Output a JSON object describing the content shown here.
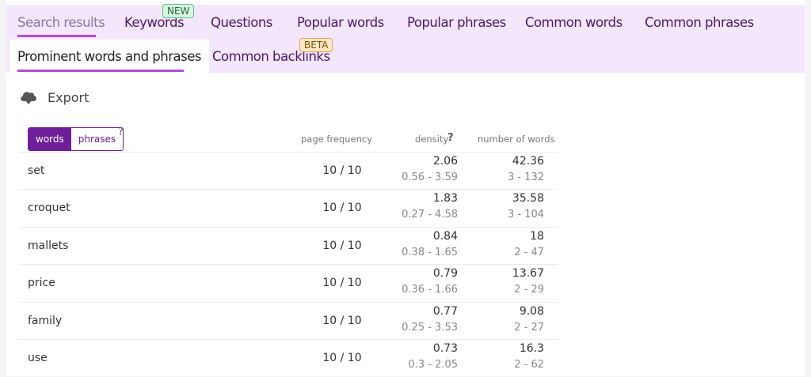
{
  "tabs_row1": [
    {
      "label": "Search results"
    },
    {
      "label": "Keywords",
      "badge": "NEW"
    },
    {
      "label": "Questions"
    },
    {
      "label": "Popular words"
    },
    {
      "label": "Popular phrases"
    },
    {
      "label": "Common words"
    },
    {
      "label": "Common phrases"
    }
  ],
  "tabs_row2": [
    {
      "label": "Prominent words and phrases"
    },
    {
      "label": "Common backlinks",
      "badge": "BETA"
    }
  ],
  "export_label": "Export",
  "toggle": {
    "words": "words",
    "phrases": "phrases",
    "help": "?"
  },
  "columns": {
    "page_frequency": "page frequency",
    "density": "density",
    "density_help": "?",
    "number_of_words": "number of words"
  },
  "rows": [
    {
      "word": "set",
      "freq": "10 / 10",
      "density": "2.06",
      "density_range": "0.56 - 3.59",
      "count": "42.36",
      "count_range": "3 - 132"
    },
    {
      "word": "croquet",
      "freq": "10 / 10",
      "density": "1.83",
      "density_range": "0.27 - 4.58",
      "count": "35.58",
      "count_range": "3 - 104"
    },
    {
      "word": "mallets",
      "freq": "10 / 10",
      "density": "0.84",
      "density_range": "0.38 - 1.65",
      "count": "18",
      "count_range": "2 - 47"
    },
    {
      "word": "price",
      "freq": "10 / 10",
      "density": "0.79",
      "density_range": "0.36 - 1.66",
      "count": "13.67",
      "count_range": "2 - 29"
    },
    {
      "word": "family",
      "freq": "10 / 10",
      "density": "0.77",
      "density_range": "0.25 - 3.53",
      "count": "9.08",
      "count_range": "2 - 27"
    },
    {
      "word": "use",
      "freq": "10 / 10",
      "density": "0.73",
      "density_range": "0.3 - 2.05",
      "count": "16.3",
      "count_range": "2 - 62"
    }
  ],
  "colors": {
    "accent": "#6d1f9a",
    "underline": "#b04fd8",
    "tabbar_bg": "#f4e6fb"
  }
}
